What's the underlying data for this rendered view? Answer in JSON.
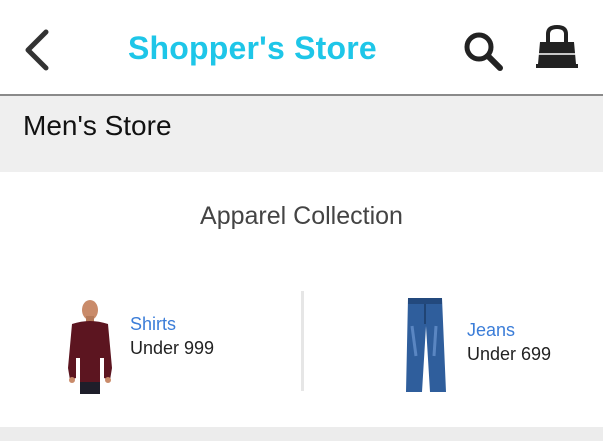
{
  "appbar": {
    "title": "Shopper's Store",
    "title_color": "#1ec6e8",
    "back_icon": "chevron-left-icon",
    "search_icon": "search-icon",
    "bag_icon": "shopping-bag-icon"
  },
  "store": {
    "title": "Men's Store"
  },
  "collection": {
    "title": "Apparel Collection",
    "items": [
      {
        "name": "Shirts",
        "price": "Under 999",
        "icon": "shirt-image"
      },
      {
        "name": "Jeans",
        "price": "Under 699",
        "icon": "jeans-image"
      }
    ]
  },
  "colors": {
    "link": "#3b7dd8",
    "header_bg": "#efefef"
  }
}
